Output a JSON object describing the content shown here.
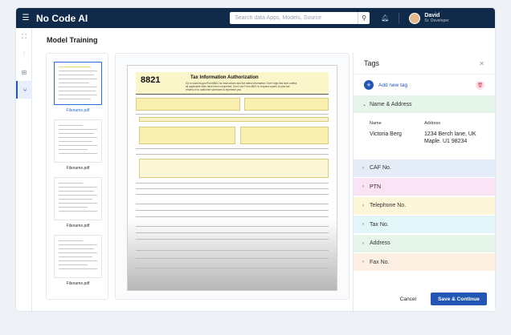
{
  "app": {
    "brand": "No Code AI"
  },
  "search": {
    "placeholder": "Search data Apps, Models, Source"
  },
  "user": {
    "name": "David",
    "role": "Sr. Developer"
  },
  "page": {
    "title": "Model Training"
  },
  "thumbnails": [
    {
      "label": "Filename.pdf",
      "selected": true
    },
    {
      "label": "Filename.pdf",
      "selected": false
    },
    {
      "label": "Filename.pdf",
      "selected": false
    },
    {
      "label": "Filename.pdf",
      "selected": false
    }
  ],
  "document": {
    "form_no": "8821",
    "title": "Tax Information Authorization",
    "subtitle": "Go to www.irs.gov/Form8821 for instructions and the latest information. Don't sign this form unless all applicable lines have been completed. Don't use Form 8821 to request copies of your tax returns or to authorize someone to represent you."
  },
  "tags_panel": {
    "title": "Tags",
    "add_label": "Add new tag",
    "expanded": {
      "label": "Name & Address",
      "name_header": "Name",
      "name_value": "Victoria Berg",
      "address_header": "Address",
      "address_value": "1234 Berch lane, UK Maple. U1 98234"
    },
    "items": [
      {
        "label": "CAF No.",
        "color": "#e4ecf8"
      },
      {
        "label": "PTN",
        "color": "#f9e3f5"
      },
      {
        "label": "Telephone No.",
        "color": "#fdf6d8"
      },
      {
        "label": "Tax No.",
        "color": "#e2f5f8"
      },
      {
        "label": "Address",
        "color": "#e6f5ea"
      },
      {
        "label": "Fax No.",
        "color": "#fdefe2"
      }
    ],
    "expanded_color": "#e6f5ea",
    "cancel_label": "Cancel",
    "save_label": "Save & Continue"
  },
  "colors": {
    "topbar": "#102a4a",
    "accent": "#2457b5"
  }
}
